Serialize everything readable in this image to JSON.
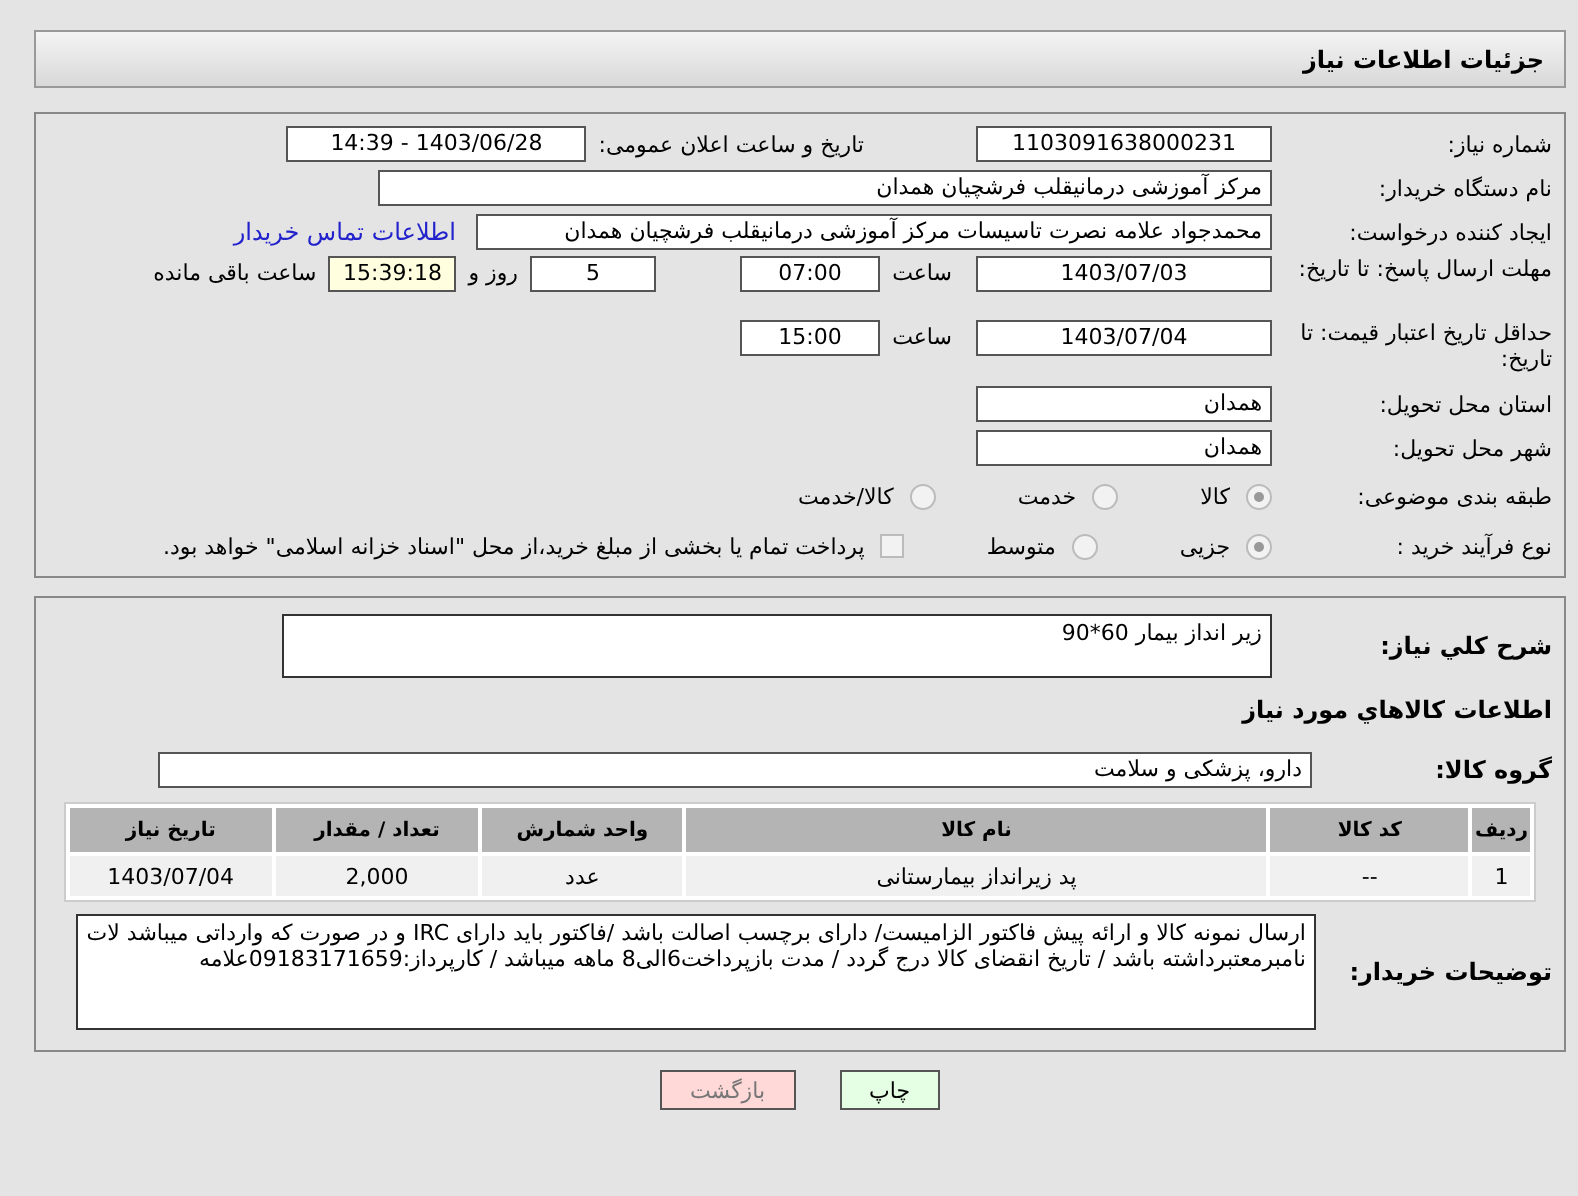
{
  "header": {
    "title": "جزئیات اطلاعات نیاز"
  },
  "info": {
    "need_number": {
      "label": "شماره نیاز:",
      "value": "1103091638000231"
    },
    "announce": {
      "label": "تاریخ و ساعت اعلان عمومی:",
      "value": "1403/06/28 - 14:39"
    },
    "buyer": {
      "label": "نام دستگاه خریدار:",
      "value": "مرکز آموزشی درمانیقلب فرشچیان همدان"
    },
    "requester": {
      "label": "ایجاد کننده درخواست:",
      "value": "محمدجواد علامه نصرت تاسیسات مرکز آموزشی درمانیقلب فرشچیان همدان",
      "link": "اطلاعات تماس خریدار"
    },
    "deadline": {
      "label": "مهلت ارسال پاسخ: تا تاریخ:",
      "date": "1403/07/03",
      "time_label": "ساعت",
      "time": "07:00",
      "days": "5",
      "days_label": "روز و",
      "remaining": "15:39:18",
      "remaining_label": "ساعت باقی مانده"
    },
    "validity": {
      "label": "حداقل تاریخ اعتبار قیمت: تا تاریخ:",
      "date": "1403/07/04",
      "time_label": "ساعت",
      "time": "15:00"
    },
    "province": {
      "label": "استان محل تحویل:",
      "value": "همدان"
    },
    "city": {
      "label": "شهر محل تحویل:",
      "value": "همدان"
    },
    "category": {
      "label": "طبقه بندی موضوعی:",
      "options": [
        {
          "label": "کالا",
          "selected": true
        },
        {
          "label": "خدمت",
          "selected": false
        },
        {
          "label": "کالا/خدمت",
          "selected": false
        }
      ]
    },
    "process": {
      "label": "نوع فرآیند خرید :",
      "options": [
        {
          "label": "جزیی",
          "selected": true
        },
        {
          "label": "متوسط",
          "selected": false
        }
      ],
      "payment": {
        "label": "پرداخت تمام یا بخشی از مبلغ خرید،از محل \"اسناد خزانه اسلامی\" خواهد بود.",
        "checked": false
      }
    }
  },
  "details": {
    "description": {
      "label": "شرح کلي نياز:",
      "value": "زیر انداز بیمار 60*90"
    },
    "goods_heading": "اطلاعات کالاهاي مورد نياز",
    "group": {
      "label": "گروه کالا:",
      "value": "دارو، پزشکی و سلامت"
    },
    "table": {
      "columns": [
        "ردیف",
        "کد کالا",
        "نام کالا",
        "واحد شمارش",
        "تعداد / مقدار",
        "تاریخ نیاز"
      ],
      "rows": [
        [
          "1",
          "--",
          "پد زیرانداز بیمارستانی",
          "عدد",
          "2,000",
          "1403/07/04"
        ]
      ]
    },
    "notes": {
      "label": "توضیحات خریدار:",
      "value": "ارسال نمونه کالا و ارائه پیش فاکتور الزامیست/ دارای برچسب اصالت باشد /فاکتور باید دارای IRC و در صورت که وارداتی میباشد لات نامبرمعتبرداشته  باشد / تاریخ انقضای کالا درج گردد / مدت بازپرداخت6الی8 ماهه میباشد / کارپرداز:09183171659علامه"
    }
  },
  "buttons": [
    {
      "label": "چاپ",
      "kind": "print"
    },
    {
      "label": "بازگشت",
      "kind": "back"
    }
  ]
}
